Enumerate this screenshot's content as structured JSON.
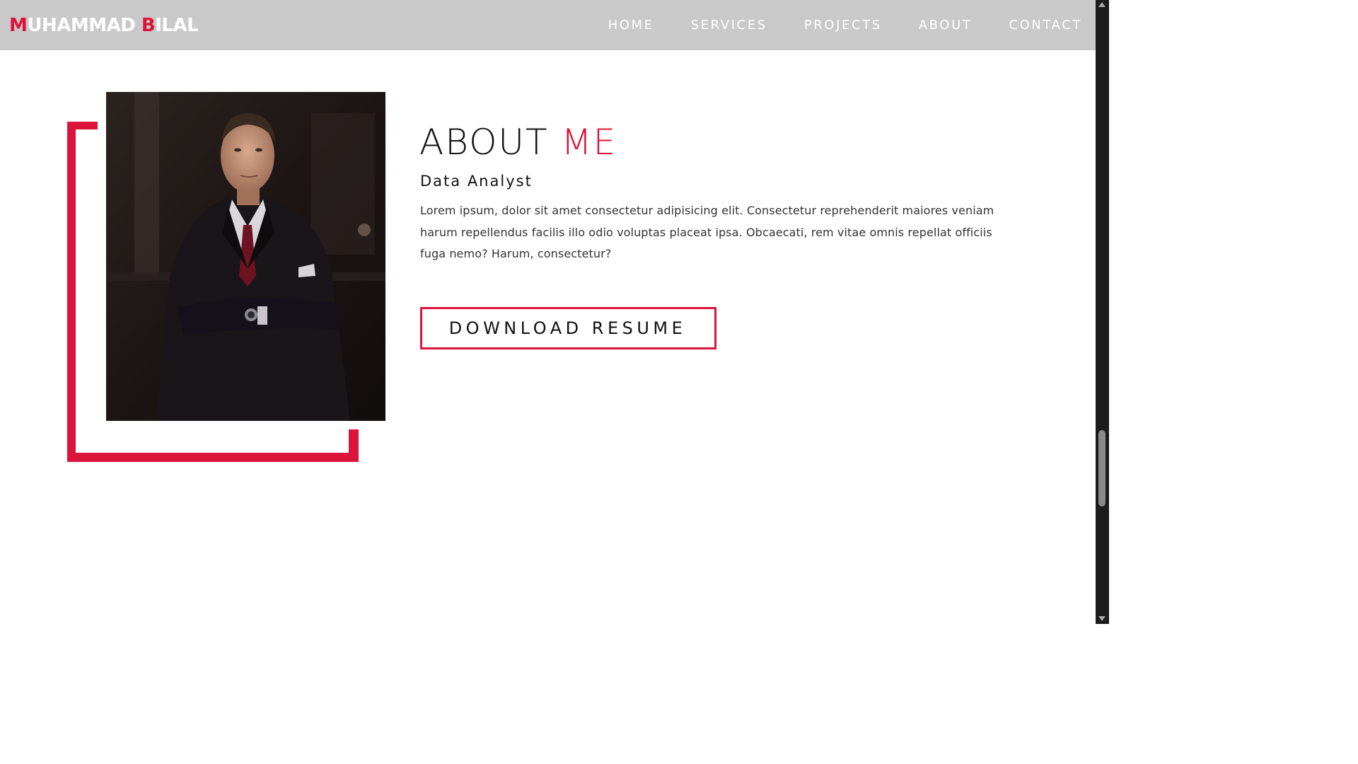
{
  "header": {
    "logo": {
      "first_initial": "M",
      "first_rest": "UHAMMAD ",
      "last_initial": "B",
      "last_rest": "ILAL"
    },
    "nav_items": [
      {
        "label": "HOME"
      },
      {
        "label": "SERVICES"
      },
      {
        "label": "PROJECTS"
      },
      {
        "label": "ABOUT"
      },
      {
        "label": "CONTACT"
      }
    ]
  },
  "about": {
    "title_main": "ABOUT ",
    "title_accent": "ME",
    "role": "Data Analyst",
    "bio": "Lorem ipsum, dolor sit amet consectetur adipisicing elit. Consectetur reprehenderit maiores veniam harum repellendus facilis illo odio voluptas placeat ipsa. Obcaecati, rem vitae omnis repellat officiis fuga nemo? Harum, consectetur?",
    "download_label": "DOWNLOAD RESUME",
    "photo_icon": "portrait-photo-icon"
  },
  "colors": {
    "accent": "#dc143c",
    "navbar_bg": "#c9c9c9",
    "text": "#111111",
    "scrollbar_bg": "#1c1c1c"
  }
}
